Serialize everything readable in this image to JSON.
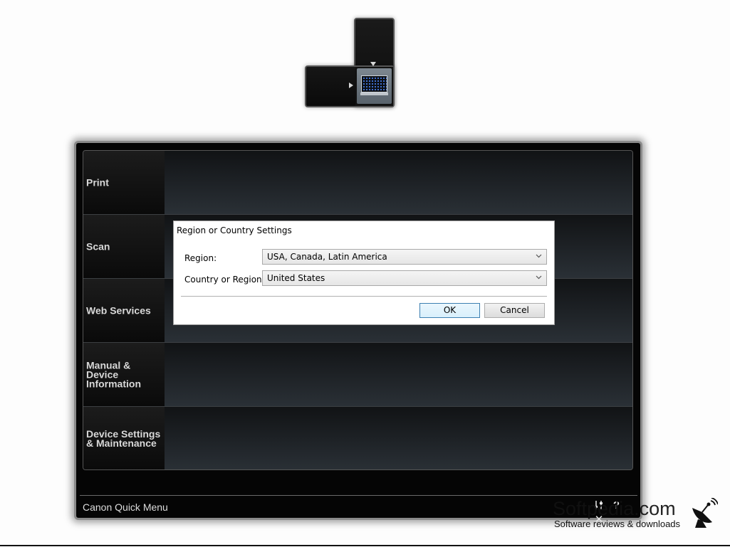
{
  "main_menu": {
    "items": [
      {
        "label": "Print"
      },
      {
        "label": "Scan"
      },
      {
        "label": "Web Services"
      },
      {
        "label": "Manual & Device Information"
      },
      {
        "label": "Device Settings & Maintenance"
      }
    ],
    "app_name": "Canon Quick Menu",
    "icons": [
      "settings-sliders-icon",
      "help-icon",
      "close-icon"
    ],
    "icon_glyphs": {
      "help": "?",
      "close": "✕"
    }
  },
  "dialog": {
    "title": "Region or Country Settings",
    "region_label": "Region:",
    "region_value": "USA, Canada, Latin America",
    "country_label": "Country or Region:",
    "country_value": "United States",
    "ok_label": "OK",
    "cancel_label": "Cancel"
  },
  "watermark": {
    "site": "Softpedia.com",
    "tagline": "Software reviews & downloads"
  }
}
